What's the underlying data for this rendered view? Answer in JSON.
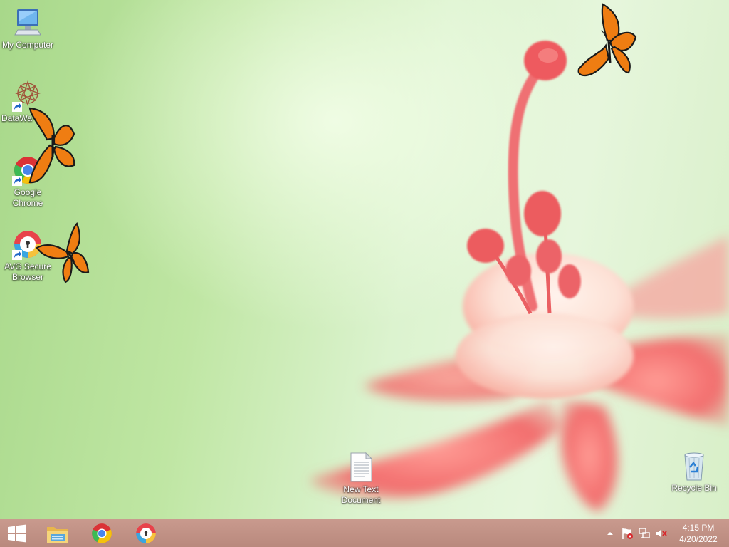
{
  "desktop": {
    "icons": [
      {
        "label": "My Computer",
        "icon": "computer-icon"
      },
      {
        "label": "DataWa",
        "icon": "datawa-icon"
      },
      {
        "label": "Google Chrome",
        "icon": "chrome-icon"
      },
      {
        "label": "AVG Secure Browser",
        "icon": "avg-secure-browser-icon"
      },
      {
        "label": "New Text Document",
        "icon": "text-document-icon"
      },
      {
        "label": "Recycle Bin",
        "icon": "recycle-bin-icon"
      }
    ],
    "decorations": [
      "butterfly-icon",
      "flower-wallpaper"
    ]
  },
  "taskbar": {
    "start": {
      "icon": "windows-logo-icon"
    },
    "pinned": [
      {
        "name": "File Explorer",
        "icon": "file-explorer-icon"
      },
      {
        "name": "Google Chrome",
        "icon": "chrome-icon"
      },
      {
        "name": "AVG Secure Browser",
        "icon": "avg-secure-browser-icon"
      }
    ],
    "tray": {
      "icons": [
        "show-hidden-icons-arrow",
        "action-center-flag-icon",
        "network-icon",
        "volume-muted-icon"
      ],
      "time": "4:15 PM",
      "date": "4/20/2022"
    }
  },
  "colors": {
    "taskbar": "#c08f83",
    "wallpaper_green": "#bfe6a3",
    "flower_pink": "#f07d7d",
    "butterfly_orange": "#ef7d12"
  }
}
